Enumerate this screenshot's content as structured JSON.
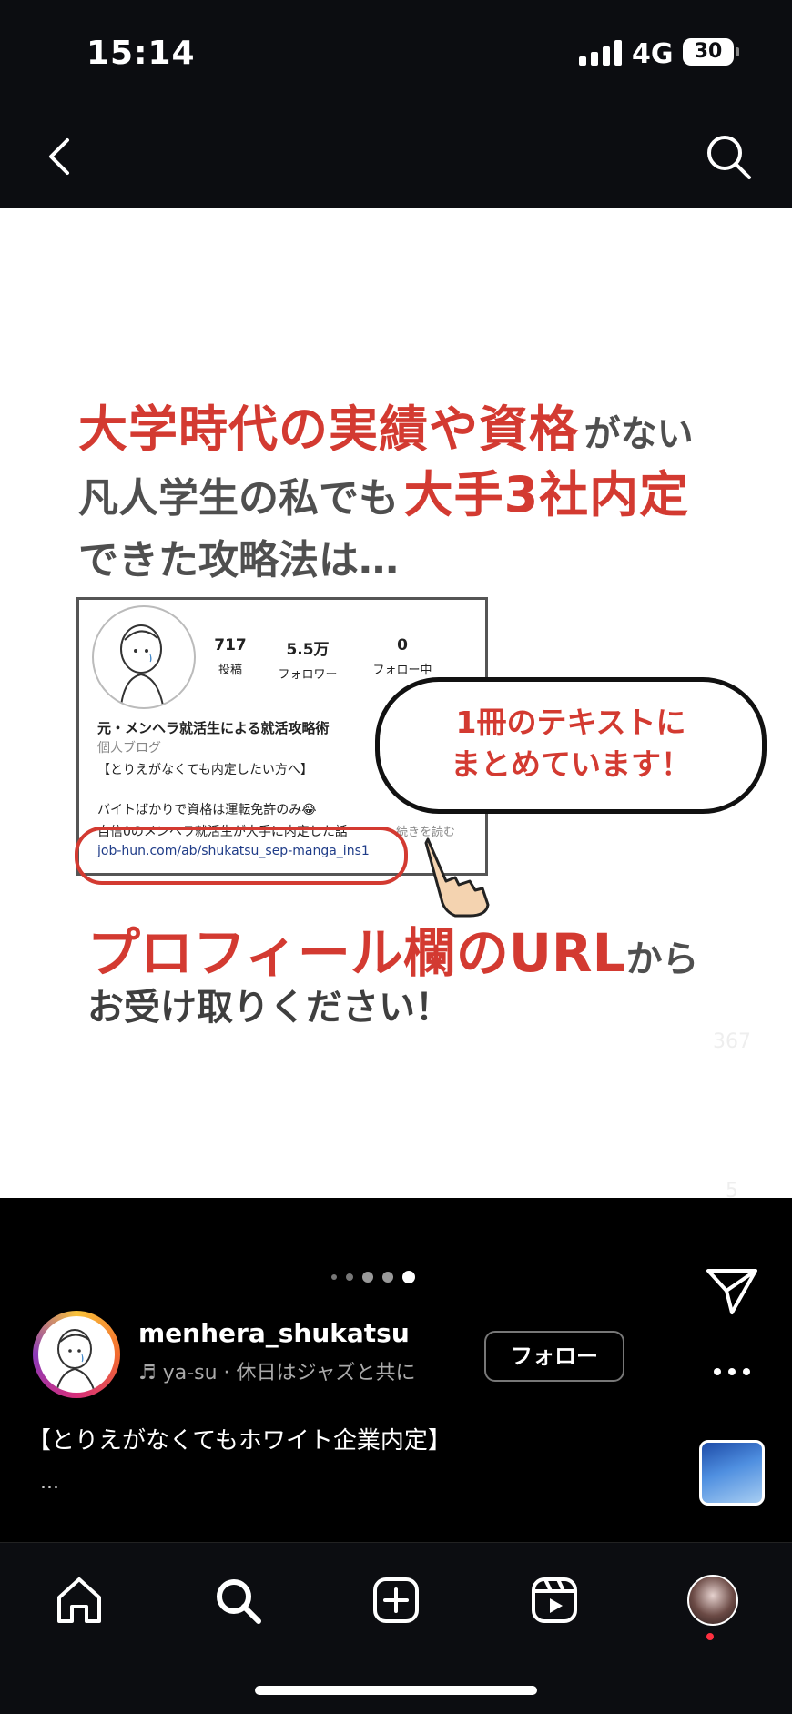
{
  "status_bar": {
    "time": "15:14",
    "network": "4G",
    "battery": "30"
  },
  "nav": {
    "back_icon": "chevron-left-icon",
    "search_icon": "search-icon"
  },
  "post_image": {
    "headline_line1_red": "大学時代の実績や資格",
    "headline_line1_gray": "がない",
    "headline_line2_gray": "凡人学生の私でも",
    "headline_line2_red": "大手3社内定",
    "headline_line3_gray": "できた攻略法は…",
    "profile_card": {
      "posts_count": "717",
      "posts_label": "投稿",
      "followers_count": "5.5万",
      "followers_label": "フォロワー",
      "following_count": "0",
      "following_label": "フォロー中",
      "name": "元・メンヘラ就活生による就活攻略術",
      "category": "個人ブログ",
      "bio_line1": "【とりえがなくても内定したい方へ】",
      "bio_line2": "バイトばかりで資格は運転免許のみ😂",
      "bio_line3": "自信0のメンヘラ就活生が大手に内定した話",
      "more_label": "続きを読む",
      "url": "job-hun.com/ab/shukatsu_sep-manga_ins1"
    },
    "bubble_line1": "1冊のテキストに",
    "bubble_line2": "まとめています！",
    "cta_line1_red": "プロフィール欄のURL",
    "cta_line1_gray": "から",
    "cta_line2": "お受け取りください！"
  },
  "actions": {
    "likes": "367",
    "comments": "5"
  },
  "carousel": {
    "total": 5,
    "active_index": 4
  },
  "user": {
    "username": "menhera_shukatsu",
    "music": "ya-su · 休日はジャズと共に",
    "follow_label": "フォロー"
  },
  "caption": {
    "text": "【とりえがなくてもホワイト企業内定】",
    "more": "..."
  },
  "bottom_nav": [
    "home-icon",
    "search-icon",
    "create-icon",
    "reels-icon",
    "profile-avatar"
  ],
  "colors": {
    "accent_red": "#d33a31",
    "background": "#000000",
    "notification": "#ff3040"
  }
}
